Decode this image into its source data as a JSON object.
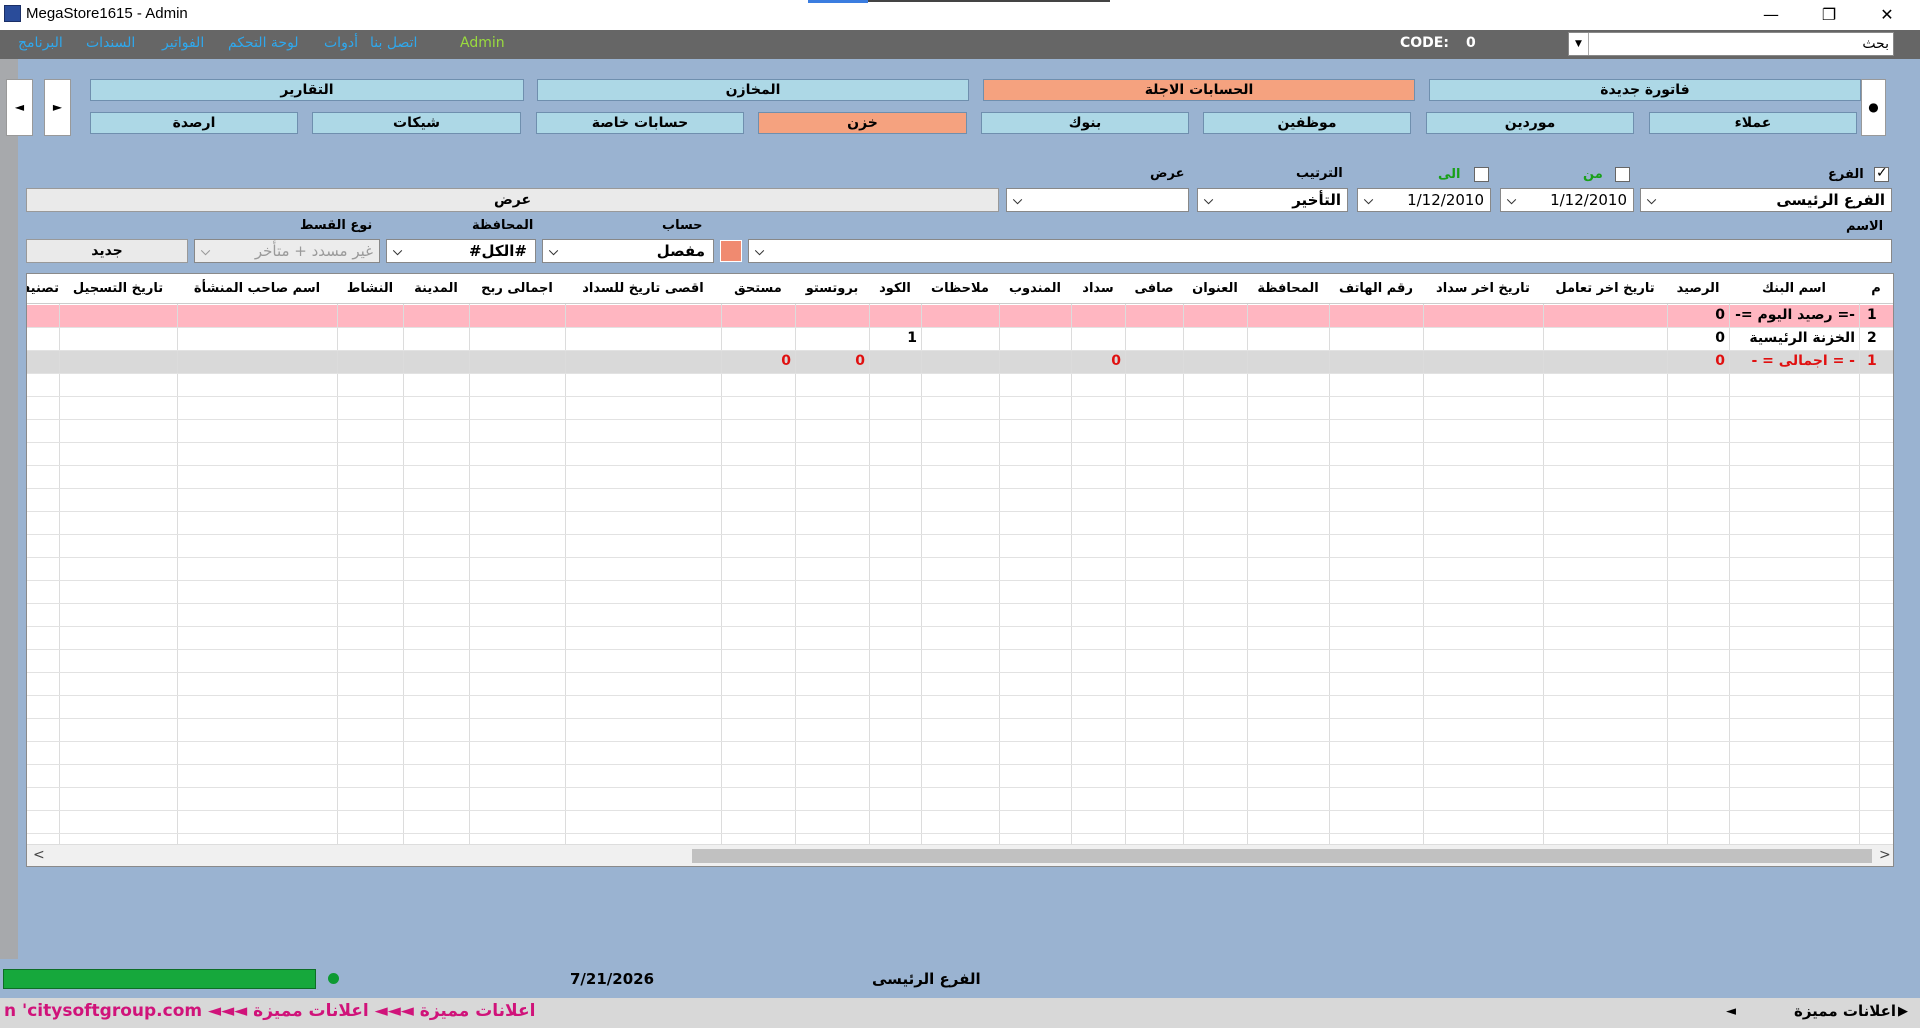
{
  "window": {
    "title": "MegaStore1615 - Admin"
  },
  "menu": {
    "items": [
      "البرنامج",
      "السندات",
      "الفواتير",
      "لوحة التحكم",
      "أدوات",
      "اتصل بنا",
      "Admin"
    ],
    "code_label": "CODE:",
    "code_value": "0",
    "search_placeholder": "بحث"
  },
  "nav": {
    "row1": [
      "التقارير",
      "المخازن",
      "الحسابات الاجلة",
      "فاتورة جديدة"
    ],
    "row2": [
      "ارصدة",
      "شيكات",
      "حسابات خاصة",
      "خزن",
      "بنوك",
      "موظفين",
      "موردين",
      "عملاء"
    ],
    "active_row1": "الحسابات الاجلة",
    "active_row2": "خزن"
  },
  "filters": {
    "branch_label": "الفرع",
    "branch_value": "الفرع الرئيسى",
    "from_label": "من",
    "to_label": "الى",
    "from_date": "1/12/2010",
    "to_date": "1/12/2010",
    "sort_label": "الترتيب",
    "sort_value": "التأخير",
    "view_label": "عرض",
    "view_value": "",
    "view_button": "عرض",
    "name_label": "الاسم",
    "name_value": "",
    "account_label": "حساب",
    "account_value": "مفصل",
    "governorate_label": "المحافظة",
    "governorate_value": "#الكل#",
    "installment_label": "نوع القسط",
    "installment_value": "غير مسدد + متأخر",
    "new_button": "جديد"
  },
  "grid": {
    "columns": [
      "م",
      "اسم البنك",
      "الرصيد",
      "تاريخ اخر تعامل",
      "تاريخ اخر سداد",
      "رقم الهاتف",
      "المحافظة",
      "العنوان",
      "صافى",
      "سداد",
      "المندوب",
      "ملاحظات",
      "الكود",
      "بروتستو",
      "مستحق",
      "اقصى تاريخ للسداد",
      "اجمالى ربح",
      "المدينة",
      "النشاط",
      "اسم صاحب المنشأة",
      "تاريخ التسجيل",
      "تصنيف"
    ],
    "rows": [
      {
        "num": "1",
        "name": "-= رصيد اليوم =-",
        "balance": "0"
      },
      {
        "num": "2",
        "name": "الخزنة الرئيسية",
        "balance": "0",
        "code": "1"
      },
      {
        "num": "1",
        "name": "- = اجمالى = -",
        "balance": "0",
        "sadad": "0",
        "protesto": "0",
        "mostahaq": "0"
      }
    ]
  },
  "status": {
    "date": "7/21/2026",
    "branch": "الفرع الرئيسى"
  },
  "ads": {
    "ticker": "n 'citysoftgroup.com ◄◄◄ اعلانات مميزة ◄◄◄ اعلانات مميزة",
    "label": "اعلانات مميزة"
  }
}
